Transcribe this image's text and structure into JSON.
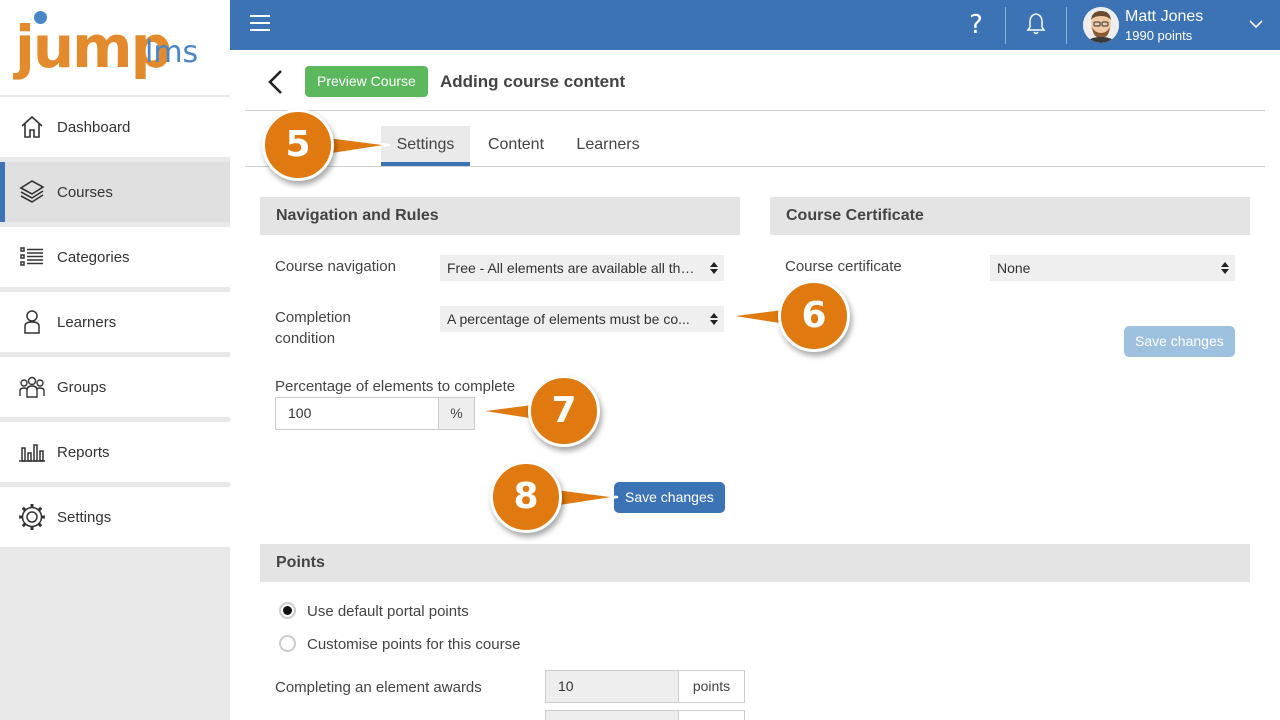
{
  "app": {
    "logo_main": "jump",
    "logo_sub": "lms"
  },
  "sidebar": {
    "items": [
      {
        "label": "Dashboard",
        "icon": "home-icon"
      },
      {
        "label": "Courses",
        "icon": "books-icon"
      },
      {
        "label": "Categories",
        "icon": "list-icon"
      },
      {
        "label": "Learners",
        "icon": "person-icon"
      },
      {
        "label": "Groups",
        "icon": "group-icon"
      },
      {
        "label": "Reports",
        "icon": "bar-chart-icon"
      },
      {
        "label": "Settings",
        "icon": "gear-icon"
      }
    ],
    "active": "Courses"
  },
  "topbar": {
    "help_icon": "?",
    "user_name": "Matt Jones",
    "user_points": "1990 points"
  },
  "header": {
    "preview_label": "Preview Course",
    "title": "Adding course content"
  },
  "tabs": [
    {
      "label": "Settings",
      "active": true
    },
    {
      "label": "Content",
      "active": false
    },
    {
      "label": "Learners",
      "active": false
    }
  ],
  "nav_rules": {
    "title": "Navigation and Rules",
    "course_nav_label": "Course navigation",
    "course_nav_value": "Free - All elements are available all the ...",
    "completion_label_1": "Completion",
    "completion_label_2": "condition",
    "completion_value": "A percentage of elements must be co...",
    "percentage_label": "Percentage of elements to complete",
    "percentage_value": "100",
    "percentage_unit": "%",
    "save_label": "Save changes"
  },
  "certificate": {
    "title": "Course Certificate",
    "label": "Course certificate",
    "value": "None",
    "save_label": "Save changes"
  },
  "points": {
    "title": "Points",
    "option_default": "Use default portal points",
    "option_custom": "Customise points for this course",
    "selected": "Use default portal points",
    "element_label": "Completing an element awards",
    "element_value": "10",
    "element_unit": "points"
  },
  "callouts": [
    "5",
    "6",
    "7",
    "8"
  ],
  "colors": {
    "primary": "#3b73b5",
    "success": "#5cb85c",
    "callout": "#e07a10",
    "logo_orange": "#e38b2c"
  }
}
